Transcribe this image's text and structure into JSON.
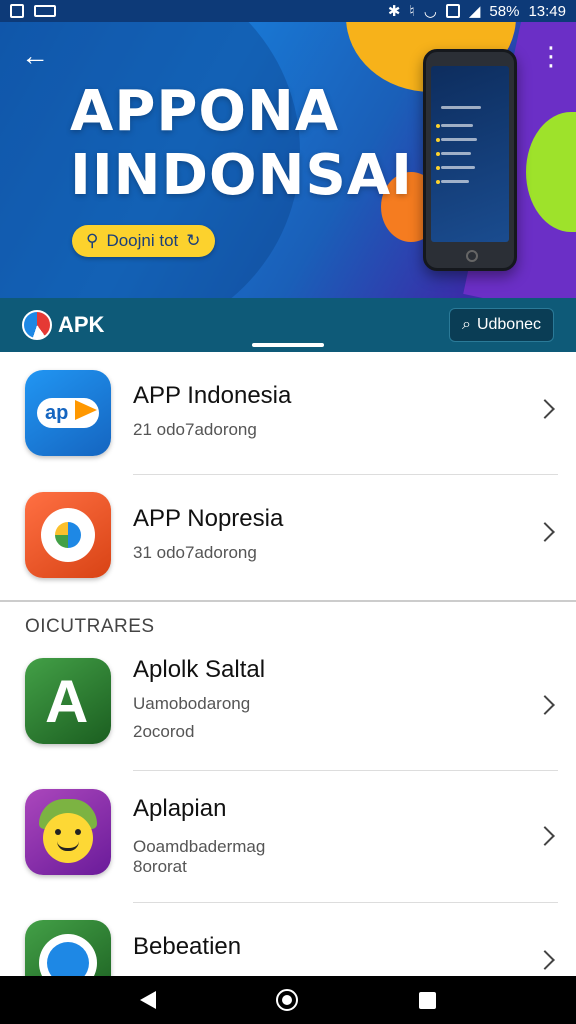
{
  "status_bar": {
    "time": "13:49",
    "battery": "58%",
    "left_icons": [
      "gallery-icon",
      "notification-icon"
    ],
    "right_icons": [
      "bluetooth-icon",
      "vibrate-icon",
      "wifi-icon",
      "sim-icon",
      "signal-icon"
    ]
  },
  "hero": {
    "title_line1": "APPONA",
    "title_line2": "IINDONSAI",
    "download_label": "Doojni tot",
    "accent_color": "#fcd22d"
  },
  "brand_bar": {
    "brand": "APK",
    "search_label": "Udbonec"
  },
  "apps": [
    {
      "name": "APP Indonesia",
      "sub": "21 odo7adorong",
      "icon": "app-indonesia-icon",
      "color": "#1e88e5"
    },
    {
      "name": "APP Nopresia",
      "sub": "31 odo7adorong",
      "icon": "app-nopresia-icon",
      "color": "#e64a19"
    }
  ],
  "section": {
    "header": "OICUTRARES",
    "apps": [
      {
        "name": "Aplolk Saltal",
        "sub": "Uamobodarong",
        "sub2": "2ocorod",
        "icon": "aplolk-saltal-icon",
        "color": "#2e7d32"
      },
      {
        "name": "Aplapian",
        "sub": "Ooamdbadermag",
        "sub2": "8ororat",
        "icon": "aplapian-icon",
        "color": "#8e24aa"
      },
      {
        "name": "Bebeatien",
        "sub": "",
        "sub2": "",
        "icon": "bebeatien-icon",
        "color": "#2e7d32"
      }
    ]
  }
}
